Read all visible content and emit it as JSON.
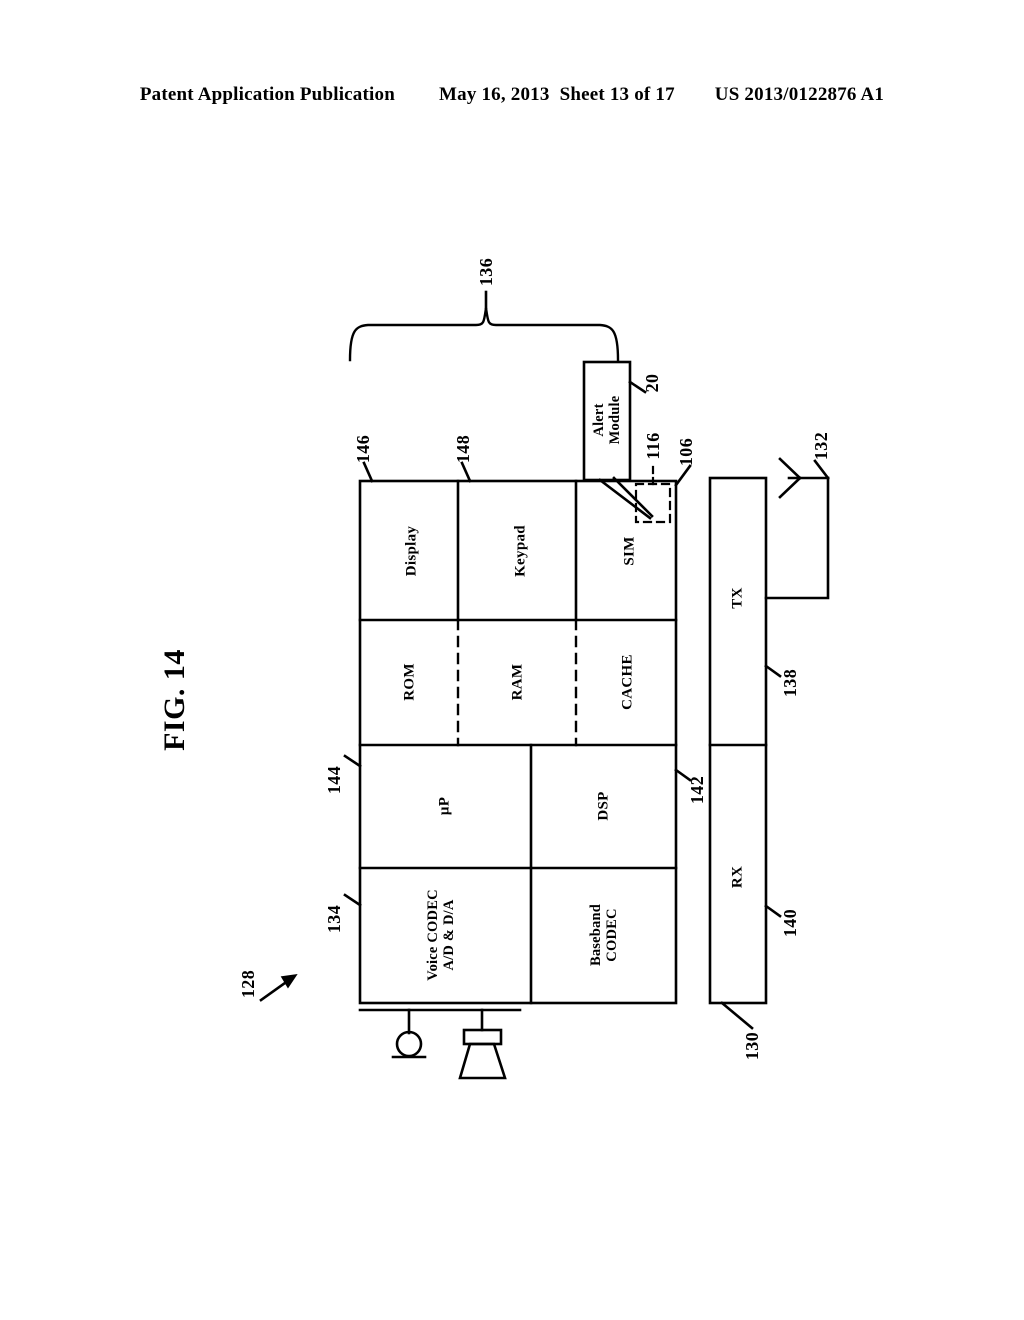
{
  "header": {
    "publication": "Patent Application Publication",
    "date": "May 16, 2013",
    "sheet": "Sheet 13 of 17",
    "number": "US 2013/0122876 A1"
  },
  "figure": {
    "title": "FIG. 14",
    "overall_ref": "128",
    "bracket_ref": "136",
    "blocks": [
      {
        "id": "voice-codec",
        "label": "Voice CODEC\nA/D & D/A",
        "ref": "134"
      },
      {
        "id": "baseband-codec",
        "label": "Baseband\nCODEC",
        "ref": ""
      },
      {
        "id": "up",
        "label": "µP",
        "ref": "144"
      },
      {
        "id": "dsp",
        "label": "DSP",
        "ref": "142"
      },
      {
        "id": "rom",
        "label": "ROM",
        "ref": ""
      },
      {
        "id": "ram",
        "label": "RAM",
        "ref": ""
      },
      {
        "id": "cache",
        "label": "CACHE",
        "ref": ""
      },
      {
        "id": "display",
        "label": "Display",
        "ref": "146"
      },
      {
        "id": "keypad",
        "label": "Keypad",
        "ref": "148"
      },
      {
        "id": "sim",
        "label": "SIM",
        "ref": "106"
      }
    ],
    "radio": {
      "rx_label": "RX",
      "tx_label": "TX",
      "rx_ref": "140",
      "tx_ref": "138",
      "bar_ref": "130",
      "antenna_ref": "132"
    },
    "callout": {
      "label": "Alert\nModule",
      "ref": "20",
      "target_ref": "116"
    },
    "transducers": {
      "microphone": "microphone-icon",
      "speaker": "speaker-icon"
    }
  },
  "colors": {
    "ink": "#000000",
    "paper": "#ffffff"
  }
}
